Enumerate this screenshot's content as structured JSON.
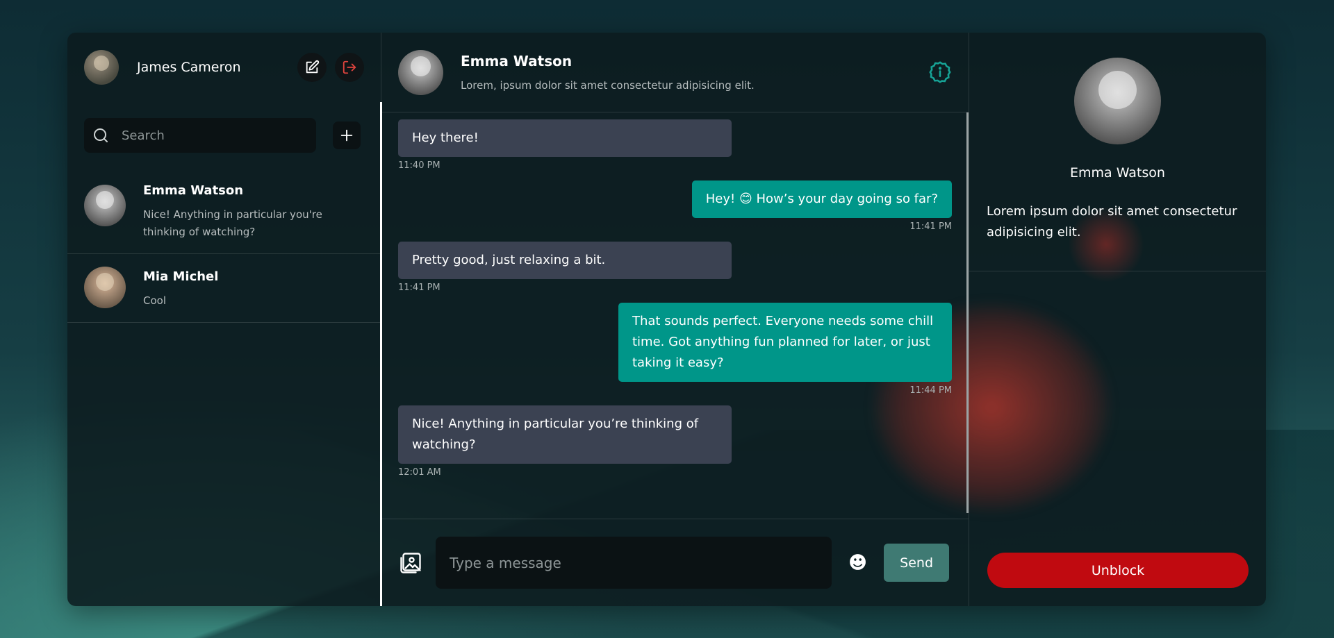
{
  "current_user": {
    "name": "James Cameron"
  },
  "search": {
    "placeholder": "Search"
  },
  "contacts": [
    {
      "name": "Emma Watson",
      "last_message": "Nice! Anything in particular you're thinking of watching?"
    },
    {
      "name": "Mia Michel",
      "last_message": "Cool"
    }
  ],
  "chat": {
    "contact_name": "Emma Watson",
    "contact_desc": "Lorem, ipsum dolor sit amet consectetur adipisicing elit.",
    "messages": [
      {
        "text": "Hey there!",
        "time": "11:40 PM",
        "own": false
      },
      {
        "text": "Hey! 😊 How’s your day going so far?",
        "time": "11:41 PM",
        "own": true
      },
      {
        "text": "Pretty good, just relaxing a bit.",
        "time": "11:41 PM",
        "own": false
      },
      {
        "text": "That sounds perfect. Everyone needs some chill time. Got anything fun planned for later, or just taking it easy?",
        "time": "11:44 PM",
        "own": true
      },
      {
        "text": "Nice! Anything in particular you’re thinking of watching?",
        "time": "12:01 AM",
        "own": false
      }
    ],
    "input_placeholder": "Type a message",
    "send_label": "Send"
  },
  "details": {
    "name": "Emma Watson",
    "bio": "Lorem ipsum dolor sit amet consectetur adipisicing elit.",
    "unblock_label": "Unblock"
  },
  "colors": {
    "accent": "#009689",
    "danger": "#c00a10",
    "bubble_other": "#3b4252"
  },
  "icons": [
    "search-icon",
    "edit-icon",
    "logout-icon",
    "plus-icon",
    "info-icon",
    "image-icon",
    "emoji-icon"
  ]
}
